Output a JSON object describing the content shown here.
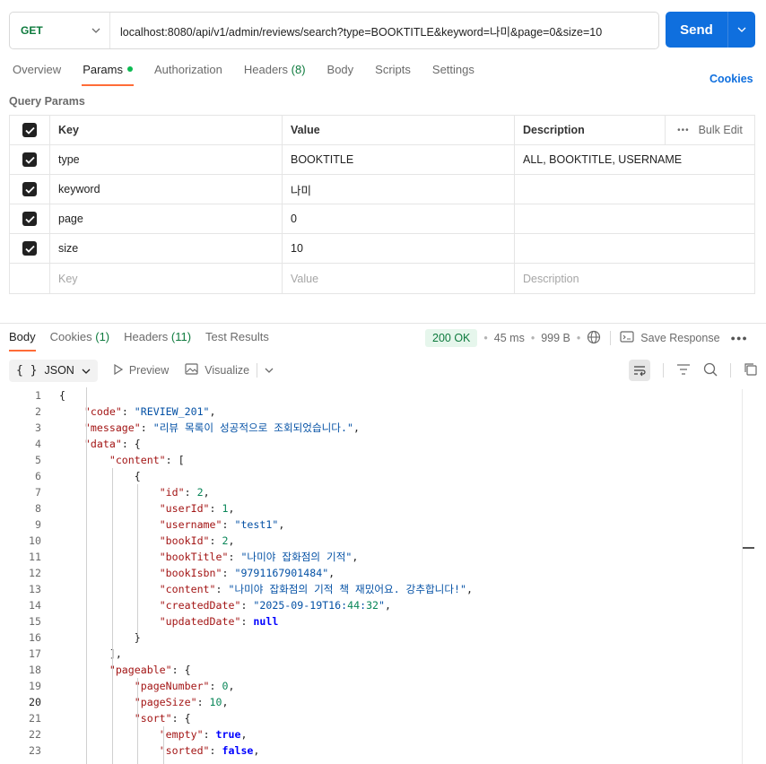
{
  "request": {
    "method": "GET",
    "url": "localhost:8080/api/v1/admin/reviews/search?type=BOOKTITLE&keyword=나미&page=0&size=10",
    "send_label": "Send"
  },
  "request_tabs": {
    "overview": "Overview",
    "params": "Params",
    "authorization": "Authorization",
    "headers": "Headers",
    "headers_count": "(8)",
    "body": "Body",
    "scripts": "Scripts",
    "settings": "Settings",
    "cookies": "Cookies"
  },
  "query_params": {
    "title": "Query Params",
    "columns": {
      "key": "Key",
      "value": "Value",
      "description": "Description",
      "bulk_edit": "Bulk Edit"
    },
    "rows": [
      {
        "key": "type",
        "value": "BOOKTITLE",
        "description": "ALL, BOOKTITLE, USERNAME"
      },
      {
        "key": "keyword",
        "value": "나미",
        "description": ""
      },
      {
        "key": "page",
        "value": "0",
        "description": ""
      },
      {
        "key": "size",
        "value": "10",
        "description": ""
      }
    ],
    "placeholders": {
      "key": "Key",
      "value": "Value",
      "description": "Description"
    }
  },
  "response_tabs": {
    "body": "Body",
    "cookies": "Cookies",
    "cookies_count": "(1)",
    "headers": "Headers",
    "headers_count": "(11)",
    "test_results": "Test Results"
  },
  "response_meta": {
    "status": "200 OK",
    "time": "45 ms",
    "size": "999 B",
    "save_response": "Save Response"
  },
  "response_toolbar": {
    "format": "JSON",
    "preview": "Preview",
    "visualize": "Visualize"
  },
  "code": {
    "current_line": 20,
    "lines": [
      "{",
      "    \"code\": \"REVIEW_201\",",
      "    \"message\": \"리뷰 목록이 성공적으로 조회되었습니다.\",",
      "    \"data\": {",
      "        \"content\": [",
      "            {",
      "                \"id\": 2,",
      "                \"userId\": 1,",
      "                \"username\": \"test1\",",
      "                \"bookId\": 2,",
      "                \"bookTitle\": \"나미야 잡화점의 기적\",",
      "                \"bookIsbn\": \"9791167901484\",",
      "                \"content\": \"나미야 잡화점의 기적 책 재밌어요. 강추합니다!\",",
      "                \"createdDate\": \"2025-09-19T16:44:32\",",
      "                \"updatedDate\": null",
      "            }",
      "        ],",
      "        \"pageable\": {",
      "            \"pageNumber\": 0,",
      "            \"pageSize\": 10,",
      "            \"sort\": {",
      "                \"empty\": true,",
      "                \"sorted\": false,"
    ]
  }
}
